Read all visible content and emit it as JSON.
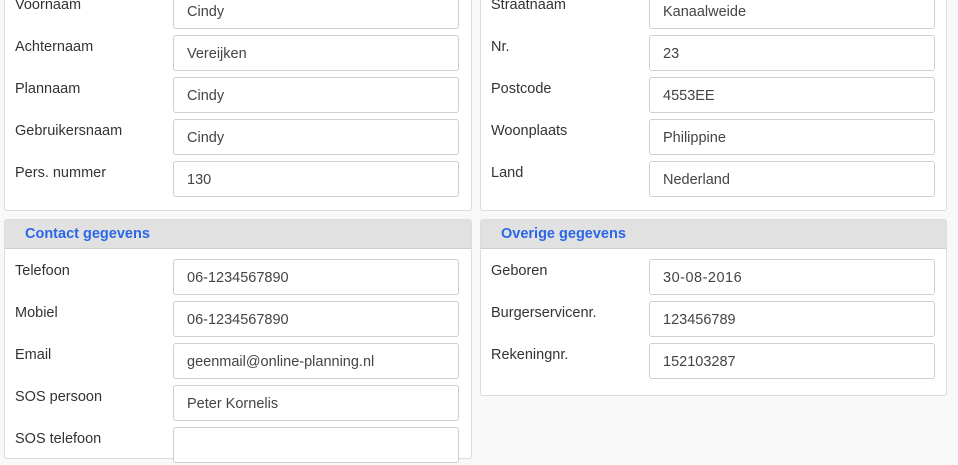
{
  "personal": {
    "rows": [
      {
        "label": "Voornaam",
        "value": "Cindy"
      },
      {
        "label": "Achternaam",
        "value": "Vereijken"
      },
      {
        "label": "Plannaam",
        "value": "Cindy"
      },
      {
        "label": "Gebruikersnaam",
        "value": "Cindy"
      },
      {
        "label": "Pers. nummer",
        "value": "130"
      }
    ]
  },
  "address": {
    "rows": [
      {
        "label": "Straatnaam",
        "value": "Kanaalweide"
      },
      {
        "label": "Nr.",
        "value": "23"
      },
      {
        "label": "Postcode",
        "value": "4553EE"
      },
      {
        "label": "Woonplaats",
        "value": "Philippine"
      },
      {
        "label": "Land",
        "value": "Nederland"
      }
    ]
  },
  "contact": {
    "title": "Contact gegevens",
    "rows": [
      {
        "label": "Telefoon",
        "value": "06-1234567890"
      },
      {
        "label": "Mobiel",
        "value": "06-1234567890"
      },
      {
        "label": "Email",
        "value": "geenmail@online-planning.nl"
      },
      {
        "label": "SOS persoon",
        "value": "Peter Kornelis"
      },
      {
        "label": "SOS telefoon",
        "value": ""
      }
    ]
  },
  "other": {
    "title": "Overige gegevens",
    "rows": [
      {
        "label": "Geboren",
        "value": "30-08-2016"
      },
      {
        "label": "Burgerservicenr.",
        "value": "123456789"
      },
      {
        "label": "Rekeningnr.",
        "value": "152103287"
      }
    ]
  }
}
